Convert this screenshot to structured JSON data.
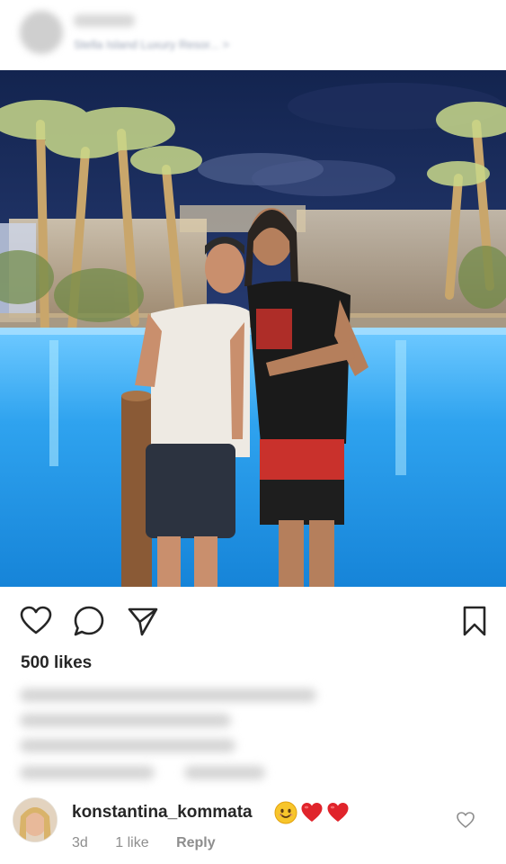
{
  "header": {
    "location": "Stella Island Luxury Resor... >"
  },
  "post": {
    "likes": "500 likes"
  },
  "actions": {
    "like_icon": "heart-outline-icon",
    "comment_icon": "comment-bubble-icon",
    "share_icon": "paper-plane-icon",
    "save_icon": "bookmark-icon"
  },
  "comment": {
    "username": "konstantina_kommata",
    "emojis": [
      "smiling-face",
      "red-heart",
      "red-heart"
    ],
    "time": "3d",
    "likes": "1 like",
    "reply": "Reply"
  },
  "colors": {
    "text": "#262626",
    "muted": "#8e8e8e",
    "pool": "#38a9f2",
    "night_sky": "#1a2a5c"
  }
}
